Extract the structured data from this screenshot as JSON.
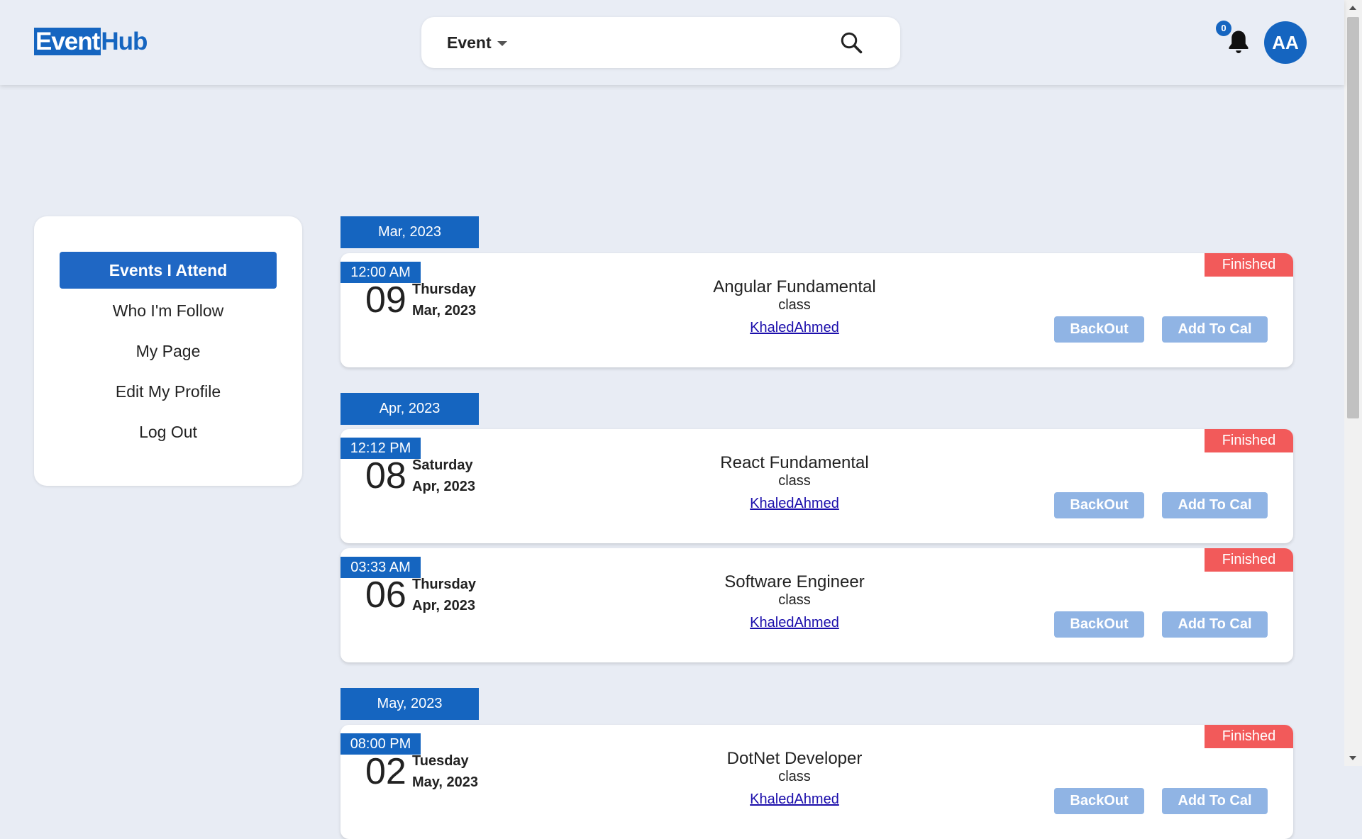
{
  "header": {
    "logo_part1": "Event",
    "logo_part2": "Hub",
    "search_type": "Event",
    "search_placeholder": "",
    "notification_count": "0",
    "avatar_initials": "AA"
  },
  "sidebar": {
    "items": [
      {
        "label": "Events I Attend",
        "active": true
      },
      {
        "label": "Who I'm Follow",
        "active": false
      },
      {
        "label": "My Page",
        "active": false
      },
      {
        "label": "Edit My Profile",
        "active": false
      },
      {
        "label": "Log Out",
        "active": false
      }
    ]
  },
  "feed": {
    "months": [
      "Mar, 2023",
      "Apr, 2023",
      "May, 2023"
    ],
    "events": [
      {
        "time": "12:00 AM",
        "day": "09",
        "weekday": "Thursday",
        "month_year": "Mar, 2023",
        "title": "Angular Fundamental",
        "type": "class",
        "organizer": "KhaledAhmed",
        "status": "Finished",
        "backout_label": "BackOut",
        "addcal_label": "Add To Cal"
      },
      {
        "time": "12:12 PM",
        "day": "08",
        "weekday": "Saturday",
        "month_year": "Apr, 2023",
        "title": "React Fundamental",
        "type": "class",
        "organizer": "KhaledAhmed",
        "status": "Finished",
        "backout_label": "BackOut",
        "addcal_label": "Add To Cal"
      },
      {
        "time": "03:33 AM",
        "day": "06",
        "weekday": "Thursday",
        "month_year": "Apr, 2023",
        "title": "Software Engineer",
        "type": "class",
        "organizer": "KhaledAhmed",
        "status": "Finished",
        "backout_label": "BackOut",
        "addcal_label": "Add To Cal"
      },
      {
        "time": "08:00 PM",
        "day": "02",
        "weekday": "Tuesday",
        "month_year": "May, 2023",
        "title": "DotNet Developer",
        "type": "class",
        "organizer": "KhaledAhmed",
        "status": "Finished",
        "backout_label": "BackOut",
        "addcal_label": "Add To Cal"
      }
    ]
  },
  "colors": {
    "primary": "#1565c0",
    "status_finished": "#f25a5a",
    "button_disabled": "#90b4e4",
    "background": "#e8ecf4"
  },
  "icons": {
    "search": "search-icon",
    "notification": "bell-icon",
    "dropdown": "caret-down-icon"
  }
}
